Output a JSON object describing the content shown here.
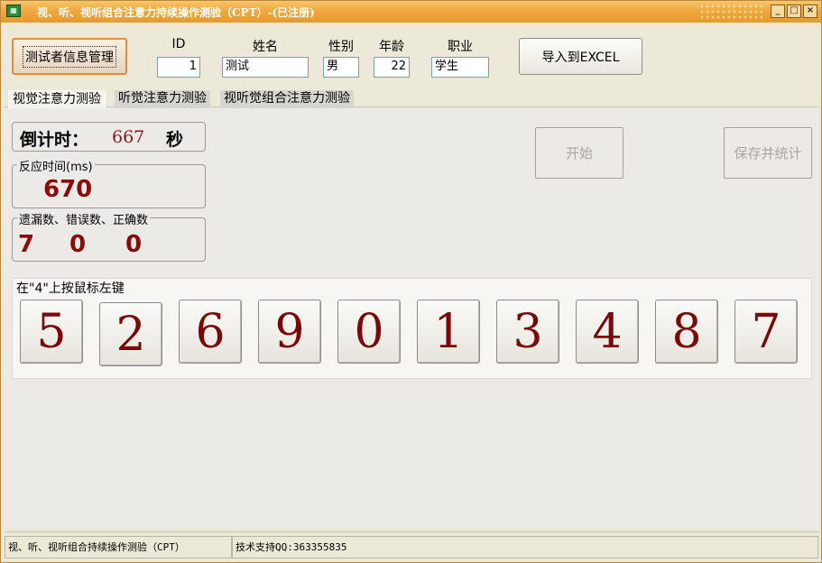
{
  "window": {
    "title": "视、听、视听组合注意力持续操作测验（CPT）-(已注册)",
    "icon_name": "app-icon",
    "controls": [
      "_",
      "□",
      "×"
    ]
  },
  "toolbar": {
    "manage_button": "测试者信息管理",
    "excel_button": "导入到EXCEL"
  },
  "subject": {
    "id_label": "ID",
    "id_value": "1",
    "name_label": "姓名",
    "name_value": "测试",
    "gender_label": "性别",
    "gender_value": "男",
    "age_label": "年龄",
    "age_value": "22",
    "job_label": "职业",
    "job_value": "学生"
  },
  "tabs": [
    {
      "label": "视觉注意力测验",
      "active": true
    },
    {
      "label": "听觉注意力测验",
      "active": false
    },
    {
      "label": "视听觉组合注意力测验",
      "active": false
    }
  ],
  "countdown": {
    "label": "倒计时：",
    "value": "667",
    "unit": "秒"
  },
  "reaction": {
    "legend": "反应时间(ms)",
    "value": "670"
  },
  "counts": {
    "legend": "遗漏数、错误数、正确数",
    "omissions": "7",
    "errors": "0",
    "correct": "0"
  },
  "actions": {
    "start": "开始",
    "save": "保存并统计"
  },
  "digits": {
    "hint": "在\"4\"上按鼠标左键",
    "values": [
      "5",
      "2",
      "6",
      "9",
      "0",
      "1",
      "3",
      "4",
      "8",
      "7"
    ]
  },
  "status": {
    "left": "视、听、视听组合持续操作测验（CPT）",
    "right": "技术支持QQ:363355835"
  },
  "colors": {
    "accent_red": "#8b0a0a",
    "titlebar": "#f0a840"
  }
}
